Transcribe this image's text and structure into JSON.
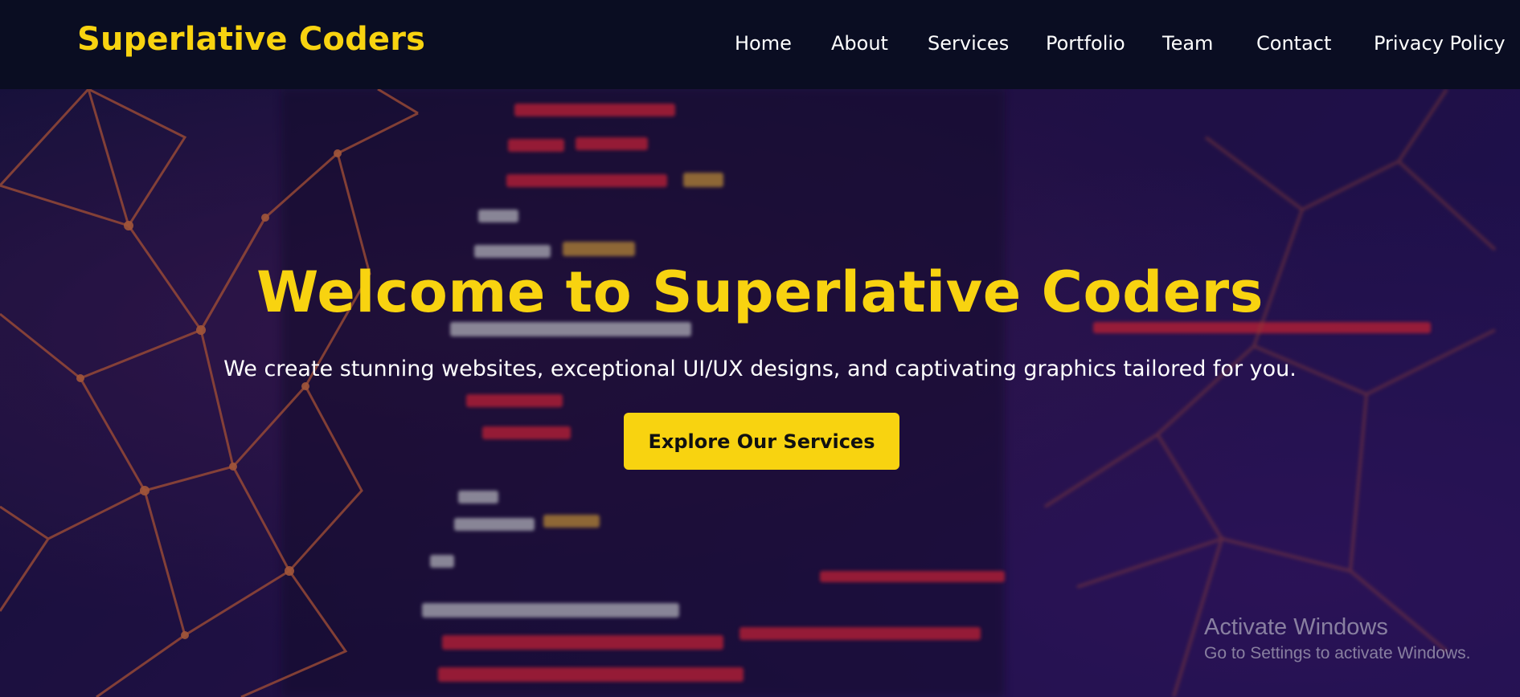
{
  "brand": "Superlative Coders",
  "nav": {
    "home": "Home",
    "about": "About",
    "services": "Services",
    "portfolio": "Portfolio",
    "team": "Team",
    "contact": "Contact",
    "privacy": "Privacy Policy"
  },
  "hero": {
    "title": "Welcome to Superlative Coders",
    "subtitle": "We create stunning websites, exceptional UI/UX designs, and captivating graphics tailored for you.",
    "cta_label": "Explore Our Services"
  },
  "watermark": {
    "title": "Activate Windows",
    "subtitle": "Go to Settings to activate Windows."
  },
  "colors": {
    "accent": "#f8d310",
    "nav_bg": "#0a0d22",
    "hero_bg": "#2a1450",
    "network_lines": "#e8703a",
    "code_red": "#ff2a3a"
  }
}
